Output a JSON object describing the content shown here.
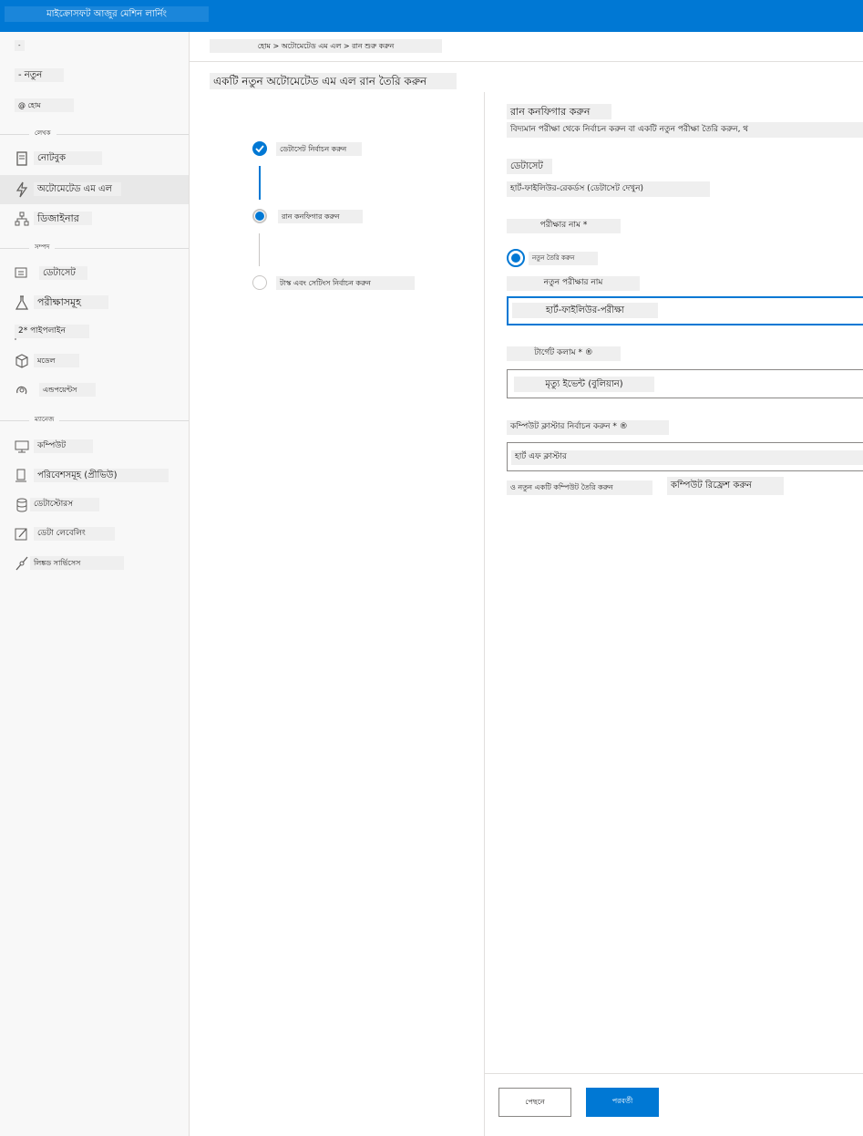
{
  "app": {
    "title": "মাইক্রোসফট আজুর মেশিন লার্নিং"
  },
  "sidebar": {
    "top": [
      {
        "label": "-"
      },
      {
        "label": "- নতুন"
      },
      {
        "label": "@ হোম"
      }
    ],
    "sections": {
      "author": "লেখক",
      "assets": "সম্পদ",
      "manage": "ম্যানেজ"
    },
    "author_items": [
      {
        "label": "নোটবুক",
        "icon": "notebook-icon"
      },
      {
        "label": "অটোমেটেড এম এল",
        "icon": "lightning-icon",
        "active": true
      },
      {
        "label": "ডিজাইনার",
        "icon": "designer-icon"
      }
    ],
    "assets_items": [
      {
        "label": "ডেটাসেট",
        "icon": "dataset-icon"
      },
      {
        "label": "পরীক্ষাসমূহ",
        "icon": "flask-icon"
      },
      {
        "label": "2* পাইপলাইন",
        "icon": "pipeline-icon"
      },
      {
        "label": "মডেল",
        "icon": "cube-icon"
      },
      {
        "label": "এন্ডপয়েন্টস",
        "icon": "endpoint-icon"
      }
    ],
    "manage_items": [
      {
        "label": "কম্পিউট",
        "icon": "monitor-icon"
      },
      {
        "label": "পরিবেশসমূহ (প্রীভিউ)",
        "icon": "environment-icon"
      },
      {
        "label": "ডেটাস্টোরস",
        "icon": "database-icon"
      },
      {
        "label": "ডেটা লেবেলিং",
        "icon": "pencil-icon"
      },
      {
        "label": "লিঙ্কড সার্ভিসেস",
        "icon": "link-icon"
      }
    ]
  },
  "breadcrumb": "হোম > অটোমেটেড এম এল > রান শুরু করুন",
  "page_title": "একটি নতুন অটোমেটেড এম এল রান তৈরি করুন",
  "steps": [
    {
      "label": "ডেটাসেট নির্বাচন করুন",
      "state": "done"
    },
    {
      "label": "রান কনফিগার করুন",
      "state": "current"
    },
    {
      "label": "টাস্ক এবং সেটিংস নির্বাচন করুন",
      "state": "pending"
    }
  ],
  "form": {
    "heading": "রান কনফিগার করুন",
    "description": "বিদ্যমান পরীক্ষা থেকে নির্বাচন করুন বা একটি নতুন পরীক্ষা তৈরি করুন, থ",
    "dataset_label": "ডেটাসেট",
    "dataset_value": "হার্ট-ফাইলিউর-রেকর্ডস (ডেটাসেট দেখুন)",
    "experiment_label": "পরীক্ষার নাম *",
    "radio_create_new": "নতুন তৈরি করুন",
    "new_experiment_label": "নতুন পরীক্ষার নাম",
    "new_experiment_value": "হার্ট-ফাইলিউর-পরীক্ষা",
    "target_label": "টার্গেট কলাম * ®",
    "target_value": "মৃত্যু ইভেন্ট (বুলিয়ান)",
    "cluster_label": "কম্পিউট ক্লাস্টার নির্বাচন করুন * ®",
    "cluster_value": "হার্ট এফ ক্লাস্টার",
    "create_compute_link": "ও নতুন একটি কম্পিউট তৈরি করুন",
    "refresh_compute_link": "কম্পিউট রিফ্রেশ করুন"
  },
  "footer": {
    "back": "পেছনে",
    "next": "পরবর্তী"
  },
  "colors": {
    "accent": "#0078d4",
    "sidebar_bg": "#f8f8f8"
  }
}
